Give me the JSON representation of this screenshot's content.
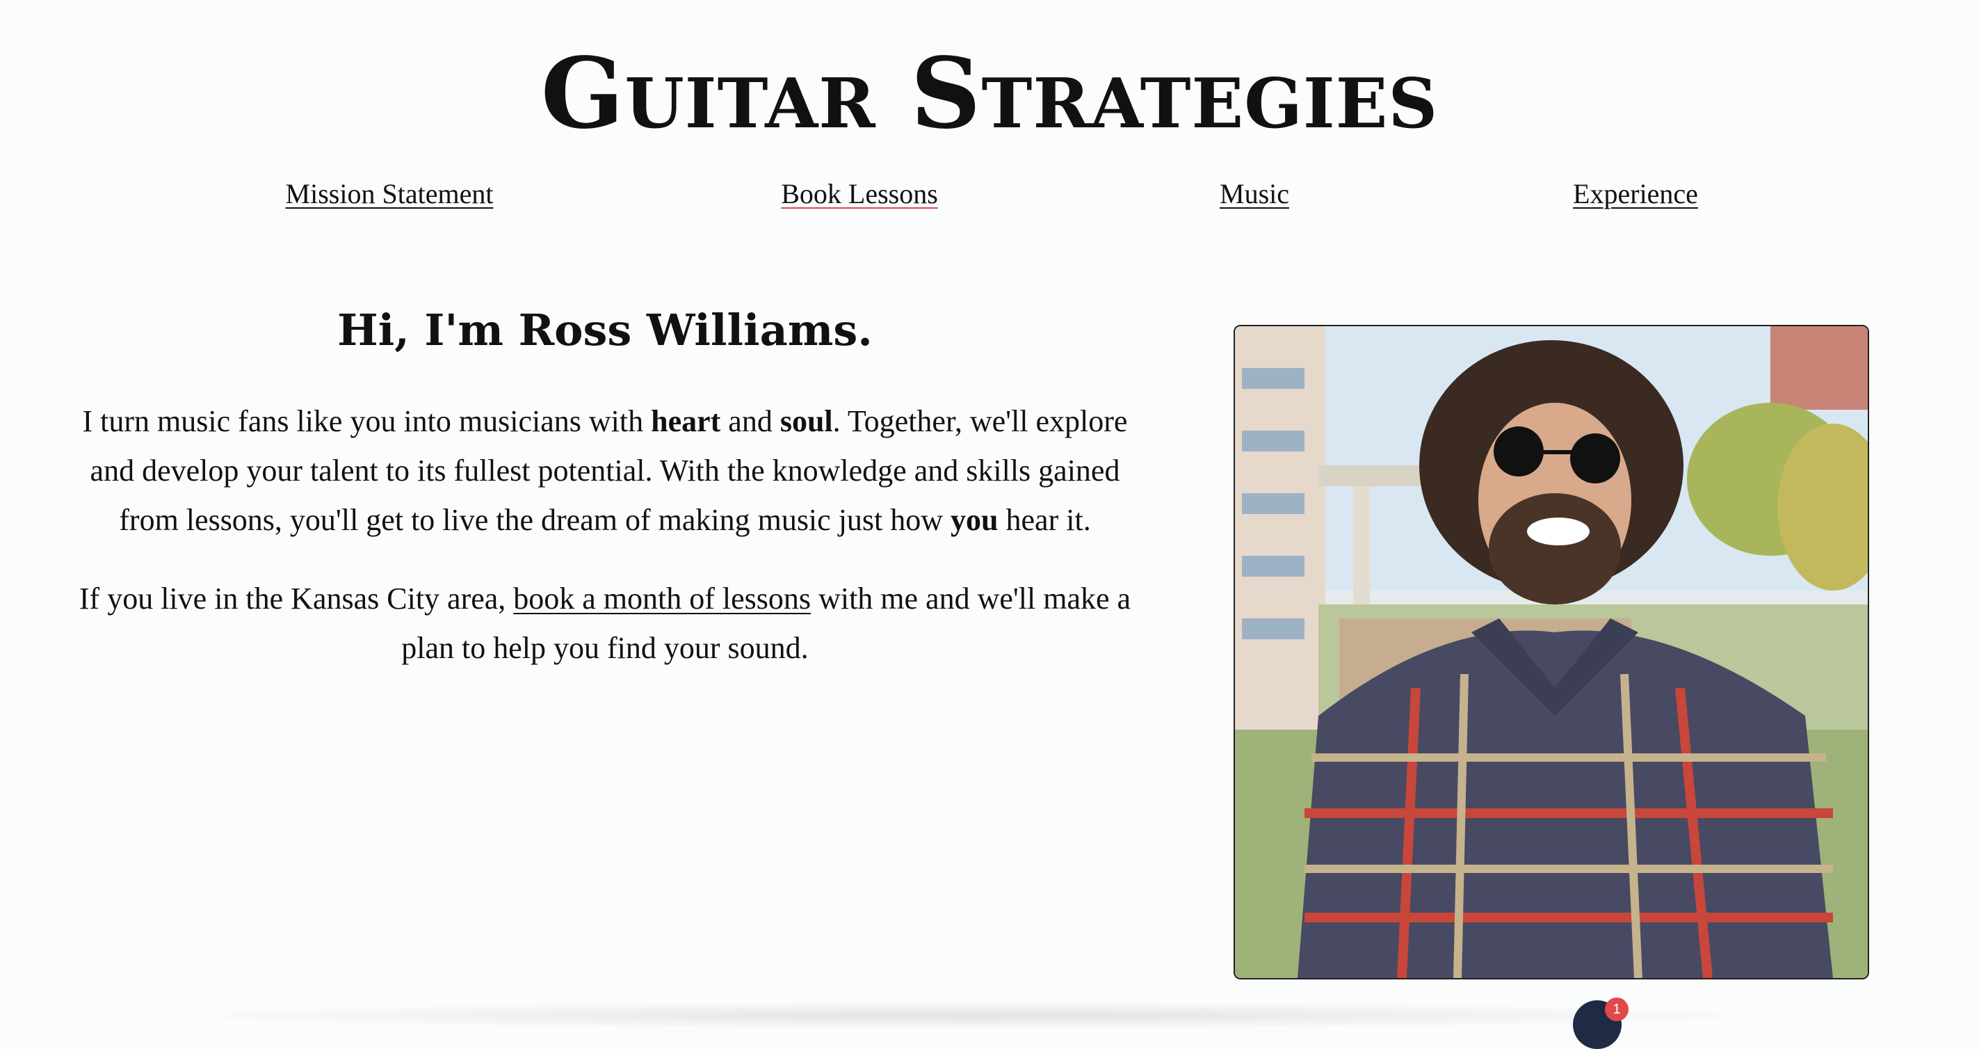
{
  "site": {
    "title": "Guitar Strategies"
  },
  "nav": {
    "items": [
      {
        "label": "Mission Statement"
      },
      {
        "label": "Book Lessons",
        "active": true
      },
      {
        "label": "Music"
      },
      {
        "label": "Experience"
      }
    ]
  },
  "intro": {
    "heading": "Hi, I'm Ross Williams.",
    "p1_a": "I turn music fans like you into musicians with ",
    "p1_bold1": "heart",
    "p1_b": " and ",
    "p1_bold2": "soul",
    "p1_c": ". Together, we'll explore and develop your talent to its fullest potential. With the knowledge and skills gained from lessons, you'll get to live the dream of making music just how ",
    "p1_bold3": "you",
    "p1_d": " hear it.",
    "p2_a": "If you live in the Kansas City area, ",
    "p2_link": "book a month of lessons",
    "p2_b": " with me and we'll make a plan to help you find your sound."
  },
  "chat": {
    "badge_count": "1"
  },
  "colors": {
    "accent_underline": "#e0494a",
    "chat_bubble": "#1f2a44",
    "page_background": "#fbfcfc"
  }
}
